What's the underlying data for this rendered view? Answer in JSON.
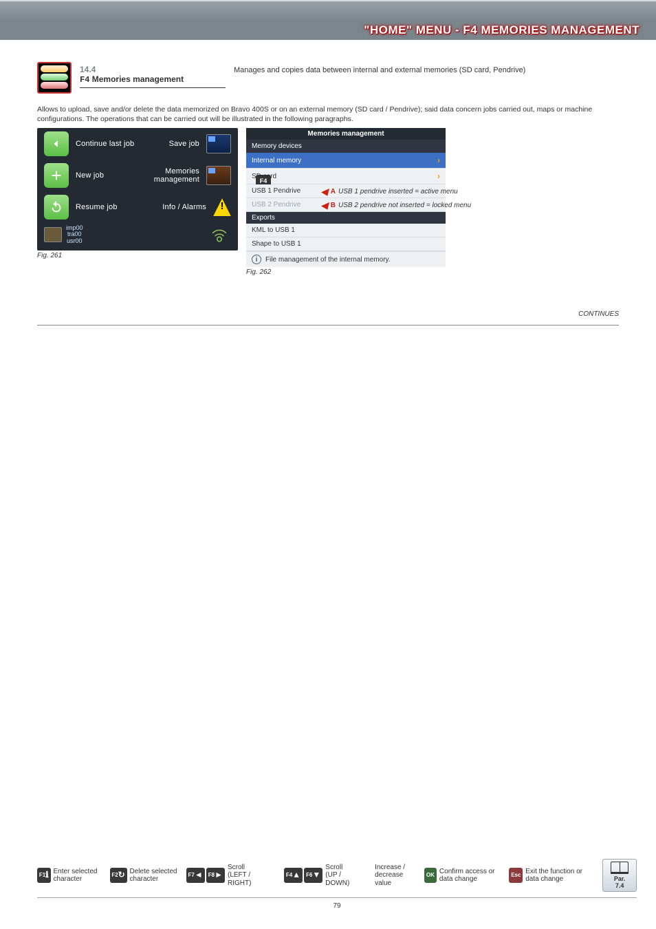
{
  "header": {
    "title": "\"HOME\" MENU - F4 MEMORIES MANAGEMENT"
  },
  "section": {
    "number": "14.4",
    "code": "F4",
    "name": "Memories management",
    "desc": "Manages and copies data between internal and external memories (SD card, Pendrive)"
  },
  "intro": "Allows to upload, save and/or delete the data memorized on Bravo 400S or on an external memory (SD card / Pendrive); said data concern jobs carried out, maps or machine configurations. The operations that can be carried out will be illustrated in the following paragraphs.",
  "fig261": {
    "label": "Fig. 261",
    "f4key": "F4",
    "btn": {
      "continue": "Continue last job",
      "save": "Save job",
      "new": "New job",
      "memories": "Memories\nmanagement",
      "resume": "Resume job",
      "info": "Info / Alarms"
    },
    "dev": "imp00\ntra00\nusr00"
  },
  "fig262": {
    "label": "Fig. 262",
    "title": "Memories management",
    "memdev": "Memory devices",
    "internal": "Internal memory",
    "sd": "SD card",
    "usb1": "USB 1 Pendrive",
    "usb2": "USB 2 Pendrive",
    "noteA": {
      "letter": "A",
      "text": "USB 1 pendrive inserted = active menu"
    },
    "noteB": {
      "letter": "B",
      "text": "USB 2 pendrive not inserted = locked menu"
    },
    "exports": "Exports",
    "kml": "KML to USB 1",
    "shape": "Shape to USB 1",
    "info": "File management of the internal memory."
  },
  "continues": "CONTINUES",
  "footer": {
    "f1": {
      "key": "F1",
      "label": "Enter selected character"
    },
    "f2": {
      "key": "F2",
      "label": "Delete selected character"
    },
    "f7": "F7",
    "f8": "F8",
    "scroll_lr": "Scroll\n(LEFT / RIGHT)",
    "f4": "F4",
    "f6": "F6",
    "scroll_ud": "Scroll\n(UP / DOWN)",
    "incdec": "Increase / decrease value",
    "ok": "OK",
    "ok_label": "Confirm access or data change",
    "esc": "Esc",
    "esc_label": "Exit the function or data change",
    "par": "Par.\n7.4"
  },
  "page": "79"
}
